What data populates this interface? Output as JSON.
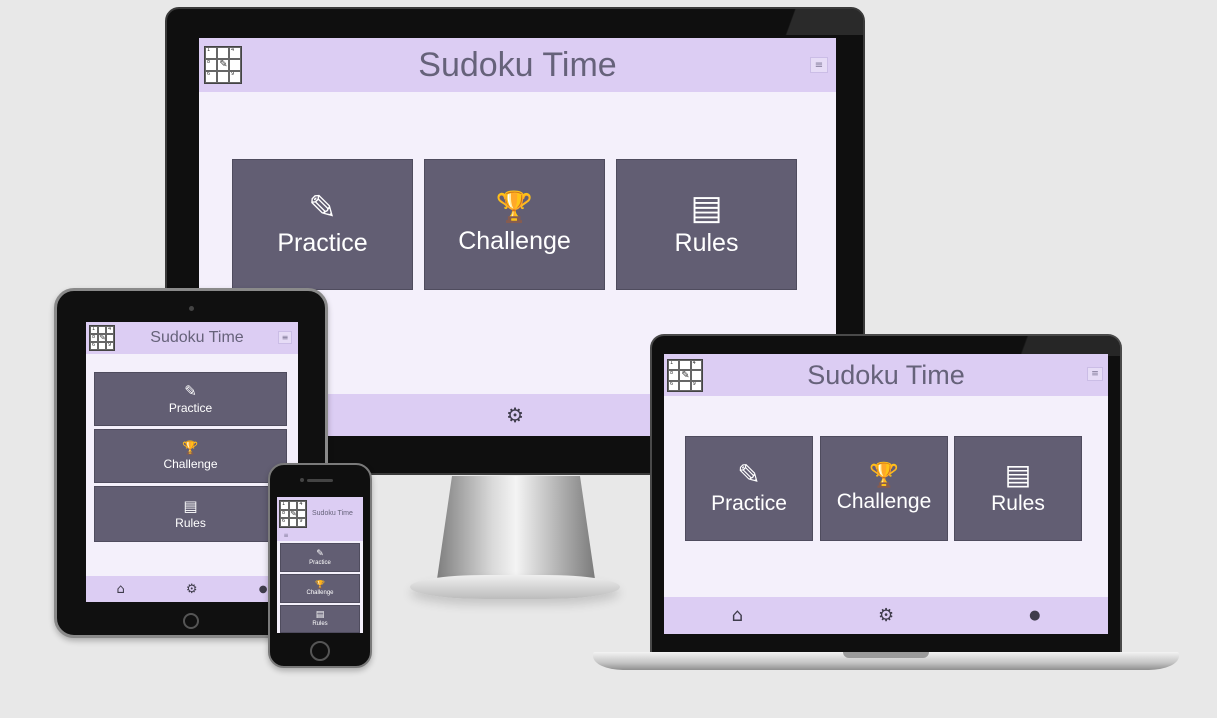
{
  "app": {
    "title": "Sudoku Time",
    "menu_icon": "≡",
    "logo_digits": [
      "1",
      "",
      "4",
      "8",
      "",
      "",
      "6",
      "",
      "9"
    ],
    "logo_pencil": "✎"
  },
  "tiles": [
    {
      "icon": "pencil-icon",
      "glyph": "✎",
      "label": "Practice"
    },
    {
      "icon": "trophy-icon",
      "glyph": "🏆",
      "label": "Challenge"
    },
    {
      "icon": "book-icon",
      "glyph": "▤",
      "label": "Rules"
    }
  ],
  "footer": {
    "home_icon": "⌂",
    "settings_icon": "⚙",
    "chat_icon": "●"
  },
  "colors": {
    "header": "#dccdf3",
    "page": "#f4f0fb",
    "tile": "#625e73",
    "title_text": "#66627a"
  }
}
